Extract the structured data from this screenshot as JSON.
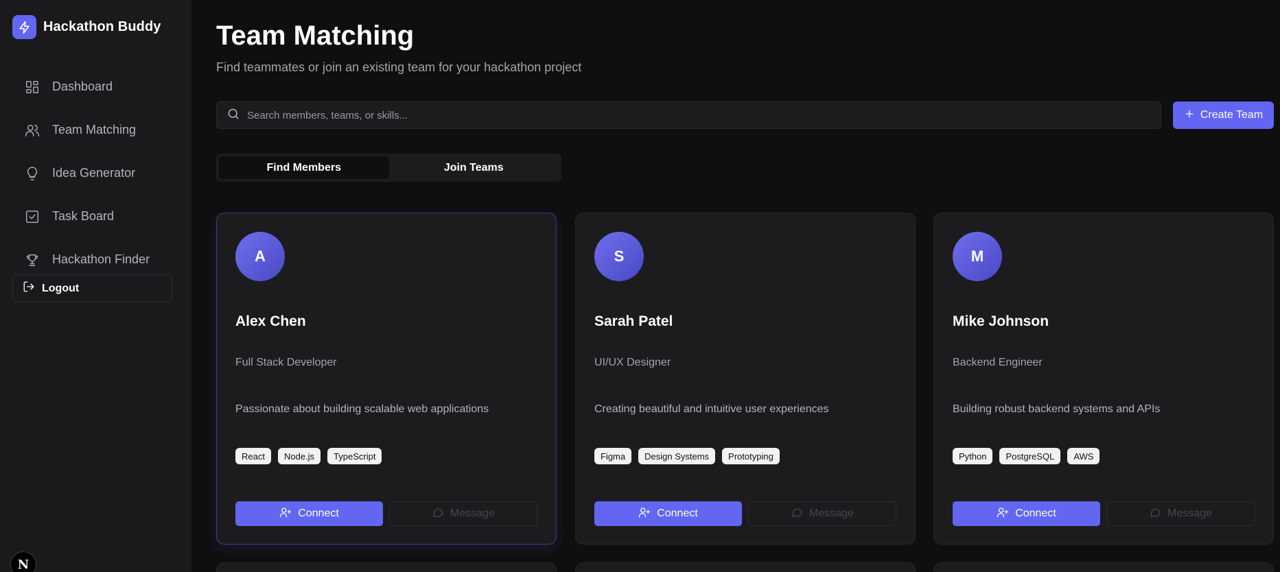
{
  "app": {
    "name": "Hackathon Buddy"
  },
  "sidebar": {
    "items": [
      {
        "label": "Dashboard",
        "icon": "layout-grid-icon"
      },
      {
        "label": "Team Matching",
        "icon": "users-icon"
      },
      {
        "label": "Idea Generator",
        "icon": "lightbulb-icon"
      },
      {
        "label": "Task Board",
        "icon": "checkbox-icon"
      },
      {
        "label": "Hackathon Finder",
        "icon": "trophy-icon"
      }
    ],
    "logout_label": "Logout",
    "badge_label": "N"
  },
  "header": {
    "title": "Team Matching",
    "subtitle": "Find teammates or join an existing team for your hackathon project"
  },
  "search": {
    "placeholder": "Search members, teams, or skills...",
    "value": ""
  },
  "actions": {
    "create_team_label": "Create Team"
  },
  "tabs": [
    {
      "label": "Find Members",
      "active": true
    },
    {
      "label": "Join Teams",
      "active": false
    }
  ],
  "members": [
    {
      "initial": "A",
      "name": "Alex Chen",
      "role": "Full Stack Developer",
      "bio": "Passionate about building scalable web applications",
      "skills": [
        "React",
        "Node.js",
        "TypeScript"
      ]
    },
    {
      "initial": "S",
      "name": "Sarah Patel",
      "role": "UI/UX Designer",
      "bio": "Creating beautiful and intuitive user experiences",
      "skills": [
        "Figma",
        "Design Systems",
        "Prototyping"
      ]
    },
    {
      "initial": "M",
      "name": "Mike Johnson",
      "role": "Backend Engineer",
      "bio": "Building robust backend systems and APIs",
      "skills": [
        "Python",
        "PostgreSQL",
        "AWS"
      ]
    }
  ],
  "card_actions": {
    "connect_label": "Connect",
    "message_label": "Message"
  },
  "colors": {
    "accent": "#6366f1",
    "background": "#0f0f10",
    "sidebar": "#1a1a1c",
    "card": "#1c1c1e"
  }
}
